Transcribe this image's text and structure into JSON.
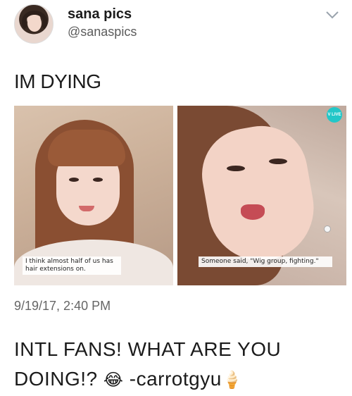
{
  "tweet": {
    "display_name": "sana pics",
    "handle": "@sanaspics",
    "text": "IM DYING",
    "timestamp": "9/19/17, 2:40 PM"
  },
  "media": {
    "left_subtitle": "I think almost half of us has hair extensions on.",
    "right_subtitle": "Someone said, \"Wig group, fighting.\"",
    "watermark": "V LIVE"
  },
  "caption": {
    "text_before_emoji": "INTL FANS! WHAT ARE YOU DOING!? ",
    "emoji_laugh": "😂",
    "text_after_emoji": " -carrotgyu",
    "emoji_icecream": "🍦"
  },
  "icons": {
    "menu": "chevron-down-icon",
    "watermark": "v-live-logo-icon"
  },
  "colors": {
    "vlive": "#22c7c8",
    "text": "#1b1b1b",
    "secondary_text": "#5b5b5b"
  }
}
